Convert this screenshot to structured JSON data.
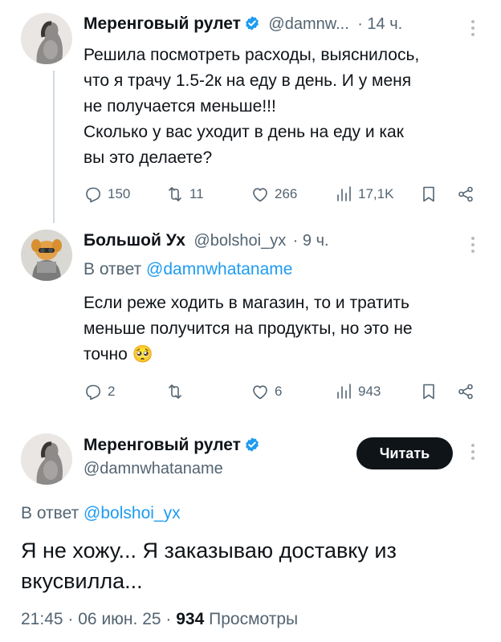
{
  "tweets": [
    {
      "name": "Меренговый рулет",
      "handle": "@damnw...",
      "time": "· 14 ч.",
      "text_lines": [
        "Решила посмотреть расходы, выяснилось,",
        "что я трачу 1.5-2к на еду в день. И у меня",
        "не получается меньше!!!",
        "Сколько у вас уходит в день на еду и как",
        "вы это делаете?"
      ],
      "replies": "150",
      "retweets": "11",
      "likes": "266",
      "views": "17,1K"
    },
    {
      "name": "Большой Ух",
      "handle": "@bolshoi_yx",
      "time": "· 9 ч.",
      "reply_prefix": "В ответ",
      "reply_to": "@damnwhataname",
      "text_lines": [
        "Если реже ходить в магазин, то и тратить",
        "меньше получится на продукты, но это не",
        "точно"
      ],
      "emoji": "🥺",
      "replies": "2",
      "retweets": "",
      "likes": "6",
      "views": "943"
    }
  ],
  "main_tweet": {
    "name": "Меренговый рулет",
    "handle": "@damnwhataname",
    "follow_label": "Читать",
    "reply_prefix": "В ответ",
    "reply_to": "@bolshoi_yx",
    "text_lines": [
      "Я не хожу... Я заказываю доставку из",
      "вкусвилла..."
    ],
    "time": "21:45",
    "date": "06 июн. 25",
    "views_count": "934",
    "views_label": "Просмотры"
  },
  "colors": {
    "accent": "#1d9bf0",
    "text": "#0f1419",
    "muted": "#536471",
    "button": "#0f1419"
  },
  "icons": [
    "verified-icon",
    "more-icon",
    "reply-icon",
    "retweet-icon",
    "like-icon",
    "views-icon",
    "bookmark-icon",
    "share-icon"
  ]
}
